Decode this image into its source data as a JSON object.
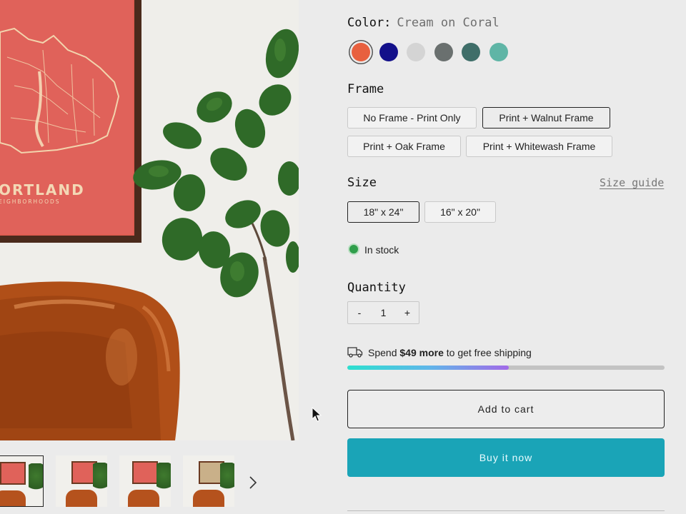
{
  "product_image": {
    "poster_title": "ORTLAND",
    "poster_subtitle": "EIGHBORHOODS"
  },
  "thumbnails": [
    {
      "label": "",
      "variant": "coral"
    },
    {
      "label": "",
      "variant": "coral"
    },
    {
      "label": "",
      "variant": "coral"
    },
    {
      "label": "",
      "variant": "tan"
    }
  ],
  "icons": {
    "next_thumbnail": "chevron-right-icon",
    "shipping": "truck-icon",
    "stock": "status-dot-icon"
  },
  "color": {
    "label": "Color:",
    "selected_value": "Cream on Coral",
    "swatches": [
      {
        "hex": "#e8603f",
        "selected": true
      },
      {
        "hex": "#13108a",
        "selected": false
      },
      {
        "hex": "#d4d4d4",
        "selected": false
      },
      {
        "hex": "#6a706f",
        "selected": false
      },
      {
        "hex": "#3f6e69",
        "selected": false
      },
      {
        "hex": "#5fb5a6",
        "selected": false
      }
    ]
  },
  "frame": {
    "label": "Frame",
    "options": [
      {
        "label": "No Frame - Print Only",
        "selected": false
      },
      {
        "label": "Print + Walnut Frame",
        "selected": true
      },
      {
        "label": "Print + Oak Frame",
        "selected": false
      },
      {
        "label": "Print + Whitewash Frame",
        "selected": false
      }
    ]
  },
  "size": {
    "label": "Size",
    "guide_link": "Size guide",
    "options": [
      {
        "label": "18\" x 24\"",
        "selected": true
      },
      {
        "label": "16\" x 20\"",
        "selected": false
      }
    ]
  },
  "stock": {
    "text": "In stock",
    "color": "#2f9e4b"
  },
  "quantity": {
    "label": "Quantity",
    "minus": "-",
    "value": "1",
    "plus": "+"
  },
  "shipping": {
    "prefix": "Spend ",
    "amount": "$49 more",
    "suffix": " to get free shipping",
    "progress_fraction": 0.51
  },
  "actions": {
    "add_to_cart": "Add to cart",
    "buy_now": "Buy it now",
    "buy_now_color": "#1aa4b7"
  }
}
